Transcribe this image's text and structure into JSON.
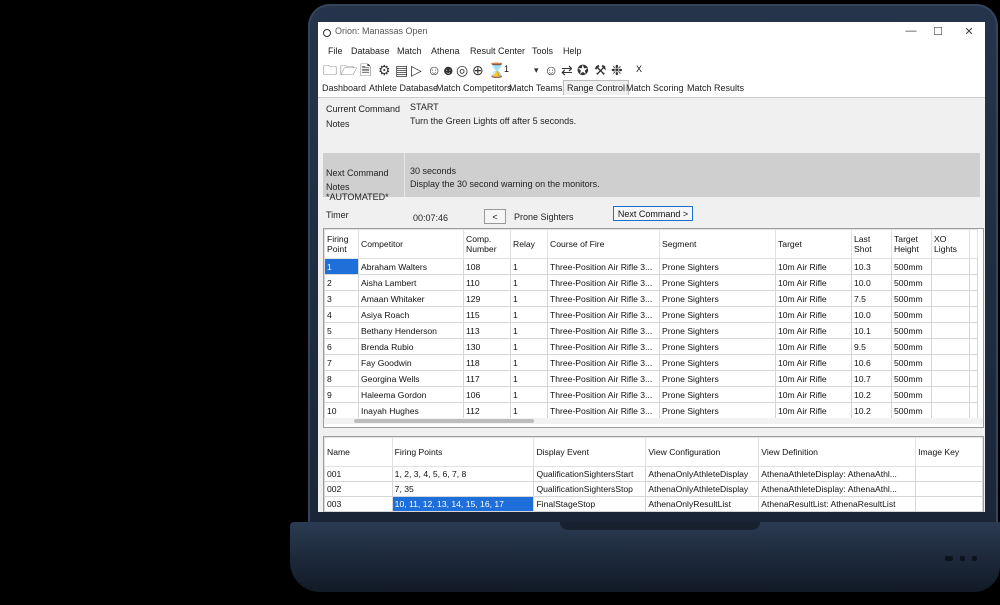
{
  "window": {
    "title": "Orion: Manassas Open",
    "controls": [
      "—",
      "☐",
      "✕"
    ]
  },
  "menu": [
    "File",
    "Database",
    "Match",
    "Athena",
    "Result Center",
    "Tools",
    "Help"
  ],
  "toolbar": {
    "relay_value": "1",
    "close_label": "X"
  },
  "tabs": [
    "Dashboard",
    "Athlete Database",
    "Match Competitors",
    "Match Teams",
    "Range Control",
    "Match Scoring",
    "Match Results"
  ],
  "active_tab": "Range Control",
  "range_control": {
    "current_command_label": "Current Command",
    "current_command": "START",
    "notes_label": "Notes",
    "notes": "Turn the Green Lights off after 5 seconds.",
    "next_command_label": "Next Command",
    "next_command": "30 seconds",
    "next_notes_label": "Notes",
    "next_notes_tag": "*AUTOMATED*",
    "next_notes": "Display the 30 second warning on the monitors.",
    "timer_label": "Timer",
    "timer": "00:07:46",
    "prev_button": "<",
    "current_segment": "Prone Sighters",
    "next_button": "Next Command >"
  },
  "competitors_table": {
    "headers": [
      "Firing Point",
      "Competitor",
      "Comp. Number",
      "Relay",
      "Course of Fire",
      "Segment",
      "Target",
      "Last Shot",
      "Target Height",
      "XO Lights"
    ],
    "rows": [
      [
        "1",
        "Abraham Walters",
        "108",
        "1",
        "Three-Position Air Rifle 3...",
        "Prone Sighters",
        "10m Air Rifle",
        "10.3",
        "500mm",
        ""
      ],
      [
        "2",
        "Aisha Lambert",
        "110",
        "1",
        "Three-Position Air Rifle 3...",
        "Prone Sighters",
        "10m Air Rifle",
        "10.0",
        "500mm",
        ""
      ],
      [
        "3",
        "Amaan Whitaker",
        "129",
        "1",
        "Three-Position Air Rifle 3...",
        "Prone Sighters",
        "10m Air Rifle",
        "7.5",
        "500mm",
        ""
      ],
      [
        "4",
        "Asiya Roach",
        "115",
        "1",
        "Three-Position Air Rifle 3...",
        "Prone Sighters",
        "10m Air Rifle",
        "10.0",
        "500mm",
        ""
      ],
      [
        "5",
        "Bethany Henderson",
        "113",
        "1",
        "Three-Position Air Rifle 3...",
        "Prone Sighters",
        "10m Air Rifle",
        "10.1",
        "500mm",
        ""
      ],
      [
        "6",
        "Brenda Rubio",
        "130",
        "1",
        "Three-Position Air Rifle 3...",
        "Prone Sighters",
        "10m Air Rifle",
        "9.5",
        "500mm",
        ""
      ],
      [
        "7",
        "Fay Goodwin",
        "118",
        "1",
        "Three-Position Air Rifle 3...",
        "Prone Sighters",
        "10m Air Rifle",
        "10.6",
        "500mm",
        ""
      ],
      [
        "8",
        "Georgina Wells",
        "117",
        "1",
        "Three-Position Air Rifle 3...",
        "Prone Sighters",
        "10m Air Rifle",
        "10.7",
        "500mm",
        ""
      ],
      [
        "9",
        "Haleema Gordon",
        "106",
        "1",
        "Three-Position Air Rifle 3...",
        "Prone Sighters",
        "10m Air Rifle",
        "10.2",
        "500mm",
        ""
      ],
      [
        "10",
        "Inayah Hughes",
        "112",
        "1",
        "Three-Position Air Rifle 3...",
        "Prone Sighters",
        "10m Air Rifle",
        "10.2",
        "500mm",
        ""
      ]
    ]
  },
  "displays_table": {
    "headers": [
      "Name",
      "Firing Points",
      "Display Event",
      "View Configuration",
      "View Definition",
      "Image Key"
    ],
    "rows": [
      [
        "001",
        "1, 2, 3, 4, 5, 6, 7, 8",
        "QualificationSightersStart",
        "AthenaOnlyAthleteDisplay",
        "AthenaAthleteDisplay:  AthenaAthl...",
        ""
      ],
      [
        "002",
        "7, 35",
        "QualificationSightersStop",
        "AthenaOnlyAthleteDisplay",
        "AthenaAthleteDisplay:  AthenaAthl...",
        ""
      ],
      [
        "003",
        "10, 11, 12, 13, 14, 15, 16, 17",
        "FinalStageStop",
        "AthenaOnlyResultList",
        "AthenaResultList:  AthenaResultList",
        ""
      ]
    ]
  }
}
